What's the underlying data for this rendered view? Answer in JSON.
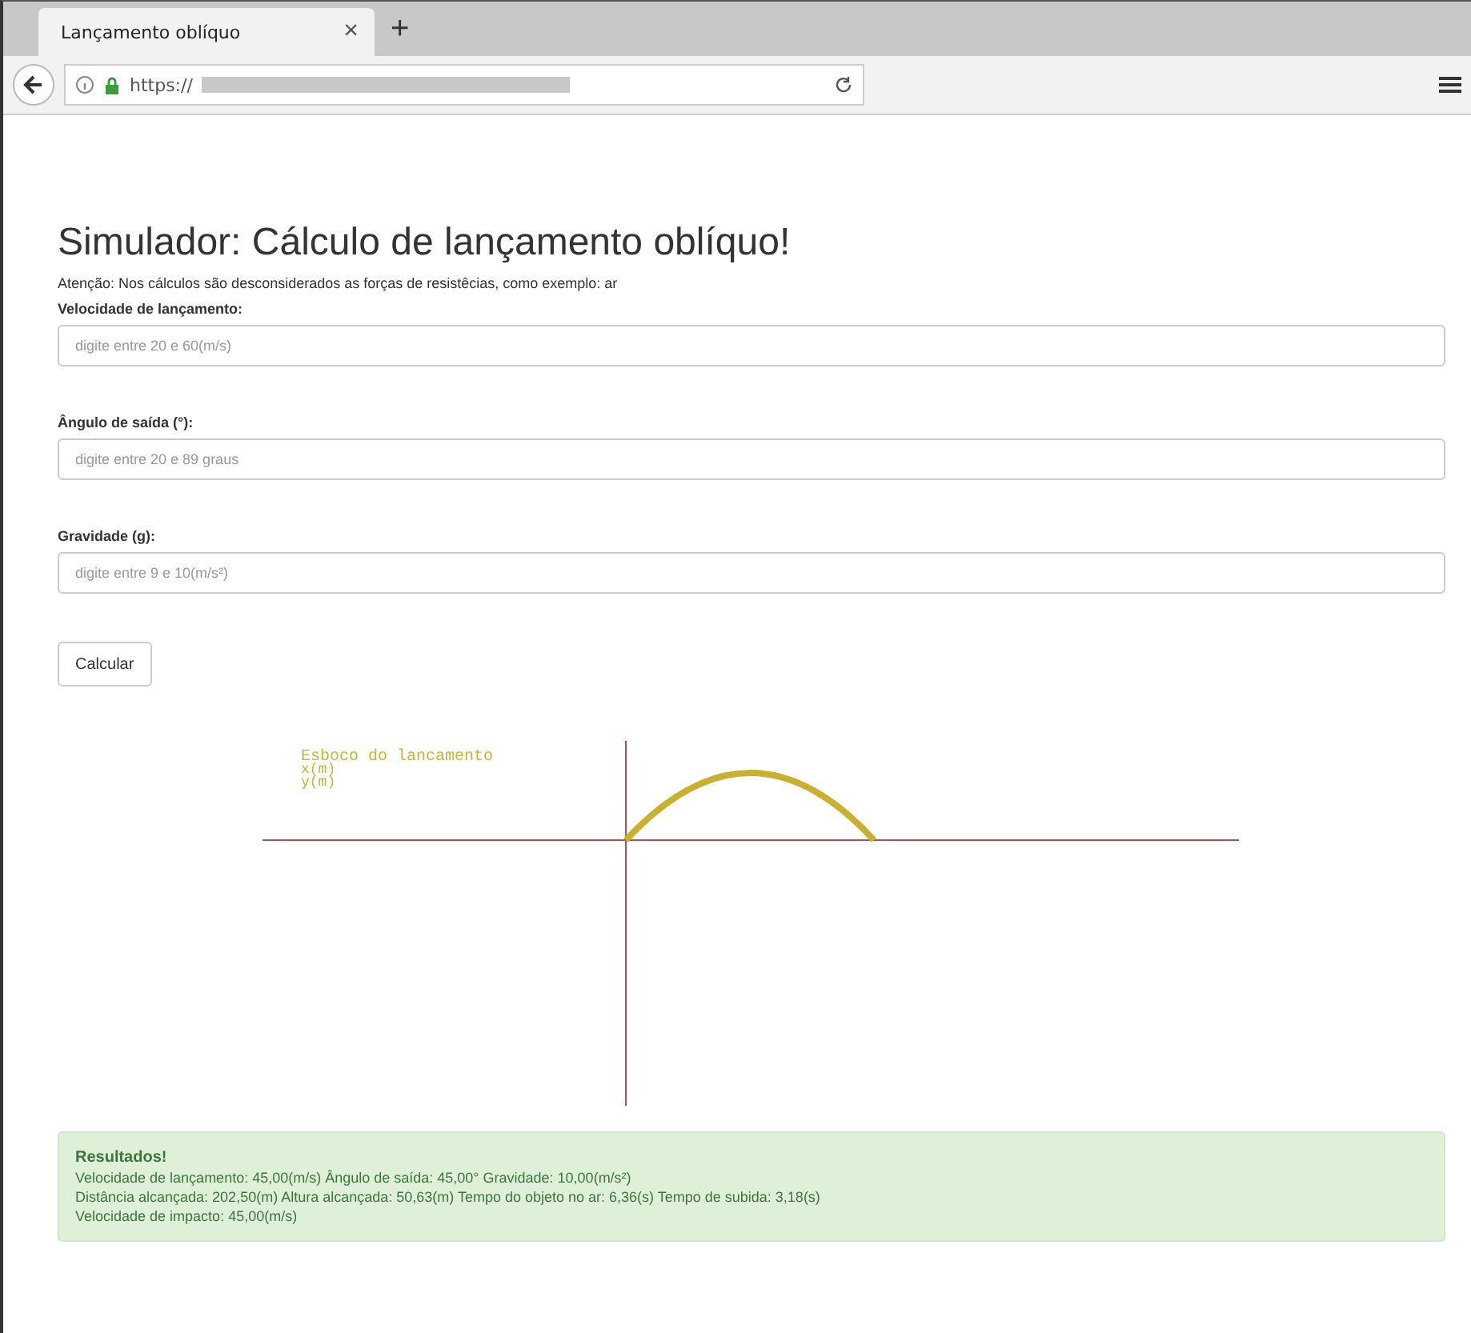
{
  "browser": {
    "tab_title": "Lançamento oblíquo",
    "tab_close": "×",
    "new_tab": "+",
    "url": "https://"
  },
  "title": "Simulador: Cálculo de lançamento oblíquo!",
  "notice": "Atenção: Nos cálculos são desconsiderados as forças de resistêcias, como exemplo: ar",
  "fields": [
    {
      "label": "Velocidade de lançamento:",
      "placeholder": "digite entre 20 e 60(m/s)"
    },
    {
      "label": "Ângulo de saída (°):",
      "placeholder": "digite entre 20 e 89 graus"
    },
    {
      "label": "Gravidade (g):",
      "placeholder": "digite entre 9 e 10(m/s²)"
    }
  ],
  "button": "Calcular",
  "sketch": {
    "title": "Esboco do lancamento",
    "x_label": "x(m)",
    "y_label": "y(m)"
  },
  "results": {
    "title": "Resultados!",
    "lines": [
      "Velocidade de lançamento: 45,00(m/s) Ângulo de saída: 45,00° Gravidade: 10,00(m/s²)",
      "Distância alcançada: 202,50(m) Altura alcançada: 50,63(m) Tempo do objeto no ar: 6,36(s) Tempo de subida: 3,18(s)",
      "Velocidade de impacto: 45,00(m/s)"
    ]
  }
}
